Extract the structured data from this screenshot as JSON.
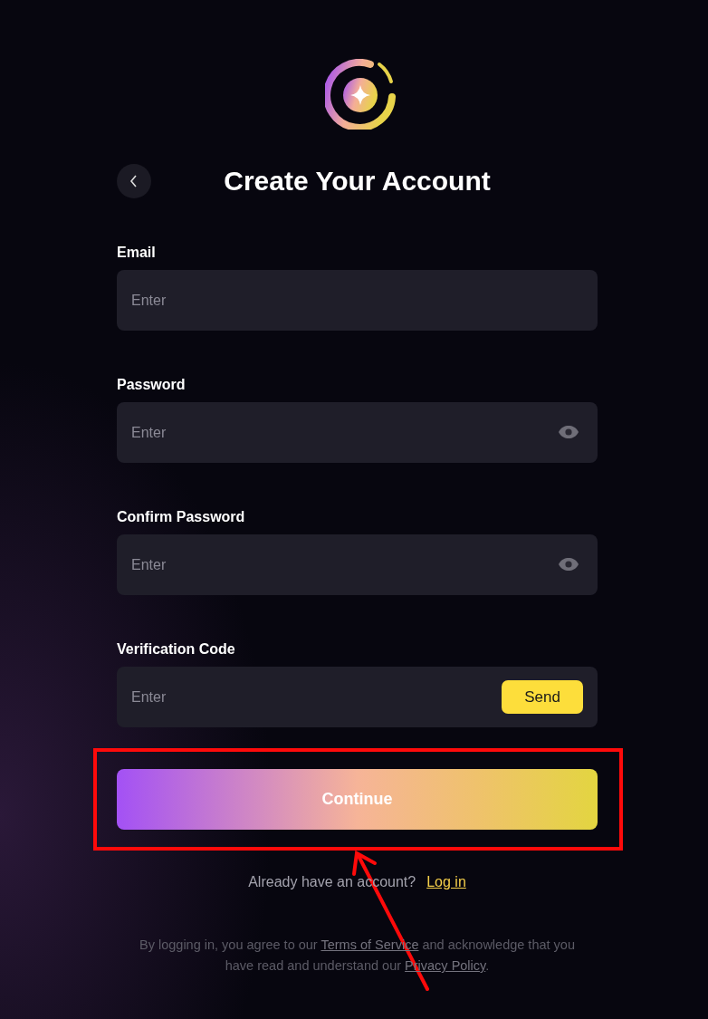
{
  "title": "Create Your Account",
  "fields": [
    {
      "kind": "text",
      "label": "Email",
      "placeholder": "Enter"
    },
    {
      "kind": "password",
      "label": "Password",
      "placeholder": "Enter"
    },
    {
      "kind": "password",
      "label": "Confirm Password",
      "placeholder": "Enter"
    },
    {
      "kind": "code",
      "label": "Verification Code",
      "placeholder": "Enter",
      "button": "Send"
    }
  ],
  "continue_button": "Continue",
  "login_prompt": {
    "text": "Already have an account?",
    "link": "Log in"
  },
  "legal": {
    "before": "By logging in, you agree to our ",
    "terms_link": "Terms of Service",
    "middle": " and acknowledge that you have read and understand our ",
    "privacy_link": "Privacy Policy",
    "after": "."
  }
}
